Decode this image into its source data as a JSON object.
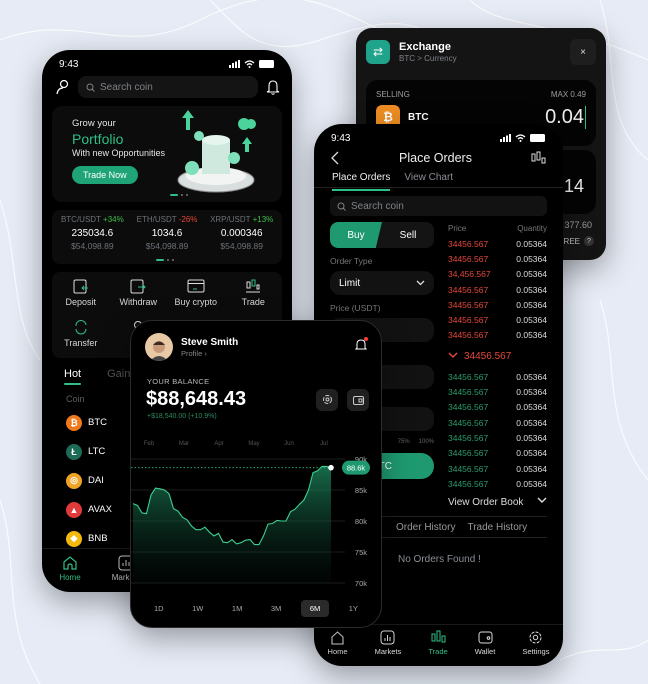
{
  "home": {
    "time": "9:43",
    "search_placeholder": "Search coin",
    "banner": {
      "line1": "Grow your",
      "line2": "Portfolio",
      "line3": "With new Opportunities",
      "button": "Trade Now"
    },
    "tickers": [
      {
        "pair": "BTC/USDT",
        "change": "+34%",
        "dir": "up",
        "value": "235034.6",
        "usd": "$54,098.89"
      },
      {
        "pair": "ETH/USDT",
        "change": "-26%",
        "dir": "down",
        "value": "1034.6",
        "usd": "$54,098.89"
      },
      {
        "pair": "XRP/USDT",
        "change": "+13%",
        "dir": "up",
        "value": "0.000346",
        "usd": "$54,098.89"
      }
    ],
    "actions_row1": [
      "Deposit",
      "Withdraw",
      "Buy crypto",
      "Trade"
    ],
    "actions_row2": [
      "Transfer"
    ],
    "tabs": [
      "Hot",
      "Gainers"
    ],
    "coin_header": "Coin",
    "coins": [
      {
        "symbol": "BTC",
        "color": "#ee7a1c",
        "glyph": "₿"
      },
      {
        "symbol": "LTC",
        "color": "#1c6b55",
        "glyph": "Ł"
      },
      {
        "symbol": "DAI",
        "color": "#f1a326",
        "glyph": "◎"
      },
      {
        "symbol": "AVAX",
        "color": "#e03a3a",
        "glyph": "▲"
      },
      {
        "symbol": "BNB",
        "color": "#f0b90b",
        "glyph": "◆"
      }
    ],
    "nav": [
      "Home",
      "Markets"
    ]
  },
  "exchange": {
    "title": "Exchange",
    "subtitle": "BTC > Currency",
    "close": "×",
    "selling_label": "SELLING",
    "max_label": "MAX 0.49",
    "coin": "BTC",
    "amount": "0.04",
    "buy_amount_partial": ".14",
    "rate_partial": "377.60",
    "fee_partial": "REE",
    "help": "?"
  },
  "orders": {
    "time": "9:43",
    "title": "Place Orders",
    "tabs": [
      "Place Orders",
      "View Chart"
    ],
    "search_placeholder": "Search coin",
    "buy": "Buy",
    "sell": "Sell",
    "order_type_label": "Order Type",
    "order_type_value": "Limit",
    "price_label": "Price (USDT)",
    "pct_labels": [
      "75%",
      "100%"
    ],
    "buy_button": "BTC",
    "book_header": {
      "price": "Price",
      "qty": "Quantity"
    },
    "asks": [
      {
        "price": "34456.567",
        "qty": "0.05364"
      },
      {
        "price": "34456.567",
        "qty": "0.05364"
      },
      {
        "price": "34,456.567",
        "qty": "0.05364"
      },
      {
        "price": "34456.567",
        "qty": "0.05364"
      },
      {
        "price": "34456.567",
        "qty": "0.05364"
      },
      {
        "price": "34456.567",
        "qty": "0.05364"
      },
      {
        "price": "34456.567",
        "qty": "0.05364"
      }
    ],
    "mid_price": "34456.567",
    "bids": [
      {
        "price": "34456.567",
        "qty": "0.05364"
      },
      {
        "price": "34456.567",
        "qty": "0.05364"
      },
      {
        "price": "34456.567",
        "qty": "0.05364"
      },
      {
        "price": "34456.567",
        "qty": "0.05364"
      },
      {
        "price": "34456.567",
        "qty": "0.05364"
      },
      {
        "price": "34456.567",
        "qty": "0.05364"
      },
      {
        "price": "34456.567",
        "qty": "0.05364"
      },
      {
        "price": "34456.567",
        "qty": "0.05364"
      }
    ],
    "view_order_book": "View Order Book",
    "history_tabs": [
      "Order History",
      "Trade History"
    ],
    "empty": "No Orders Found !",
    "nav": [
      "Home",
      "Markets",
      "Trade",
      "Wallet",
      "Settings"
    ],
    "nav_active": "Trade"
  },
  "balance": {
    "name": "Steve Smith",
    "profile": "Profile ›",
    "label": "YOUR BALANCE",
    "amount": "$88,648.43",
    "change": "+$18,540.00 (+10.9%)",
    "current_tag": "88.6k",
    "timeframes": [
      "1D",
      "1W",
      "1M",
      "3M",
      "6M",
      "1Y"
    ],
    "active_timeframe": "6M"
  },
  "chart_data": {
    "type": "area",
    "title": "",
    "x_labels": [
      "Feb",
      "Mar",
      "Apr",
      "May",
      "Jun",
      "Jul"
    ],
    "y_ticks": [
      "90k",
      "85k",
      "80k",
      "75k",
      "70k"
    ],
    "ylim": [
      70000,
      90000
    ],
    "current_value": 88600,
    "series": [
      {
        "name": "Balance",
        "values": [
          82800,
          82500,
          81300,
          81200,
          84200,
          85300,
          85200,
          85000,
          84400,
          82000,
          81600,
          80600,
          80200,
          79200,
          78600,
          78600,
          79000,
          78200,
          77600,
          78000,
          76600,
          76500,
          77000,
          76300,
          76500,
          76900,
          77000,
          76200,
          76200,
          77600,
          79500,
          79600,
          80100,
          80000,
          80000,
          81500,
          81900,
          82700,
          83400,
          85000,
          87800,
          88100,
          88800,
          88800,
          88600
        ]
      }
    ],
    "grid": true
  }
}
